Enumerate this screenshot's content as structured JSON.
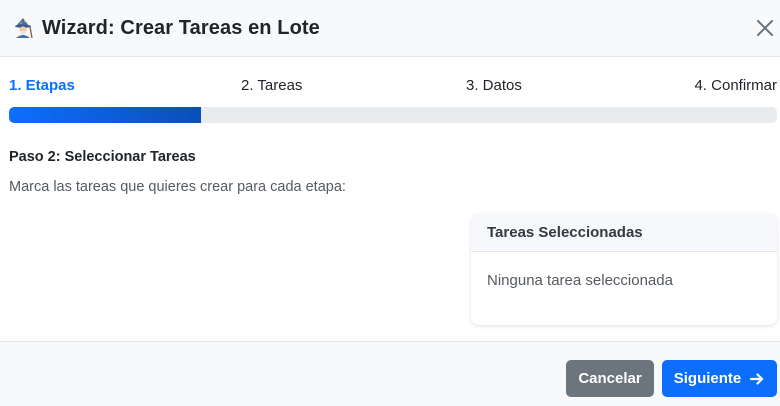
{
  "header": {
    "icon": "wizard-icon",
    "title": "Wizard: Crear Tareas en Lote",
    "close_icon": "close-icon"
  },
  "steps": [
    {
      "label": "1. Etapas",
      "active": true
    },
    {
      "label": "2. Tareas",
      "active": false
    },
    {
      "label": "3. Datos",
      "active": false
    },
    {
      "label": "4. Confirmar",
      "active": false
    }
  ],
  "progress": {
    "value_percent": 25
  },
  "content": {
    "heading": "Paso 2: Seleccionar Tareas",
    "instructions": "Marca las tareas que quieres crear para cada etapa:"
  },
  "selected_panel": {
    "title": "Tareas Seleccionadas",
    "empty_text": "Ninguna tarea seleccionada"
  },
  "footer": {
    "cancel_label": "Cancelar",
    "next_label": "Siguiente",
    "next_icon": "arrow-right-icon"
  },
  "colors": {
    "primary": "#0d6efd",
    "secondary": "#6c757d",
    "header_bg": "#f8f9fa",
    "progress_track": "#e9ecef"
  }
}
